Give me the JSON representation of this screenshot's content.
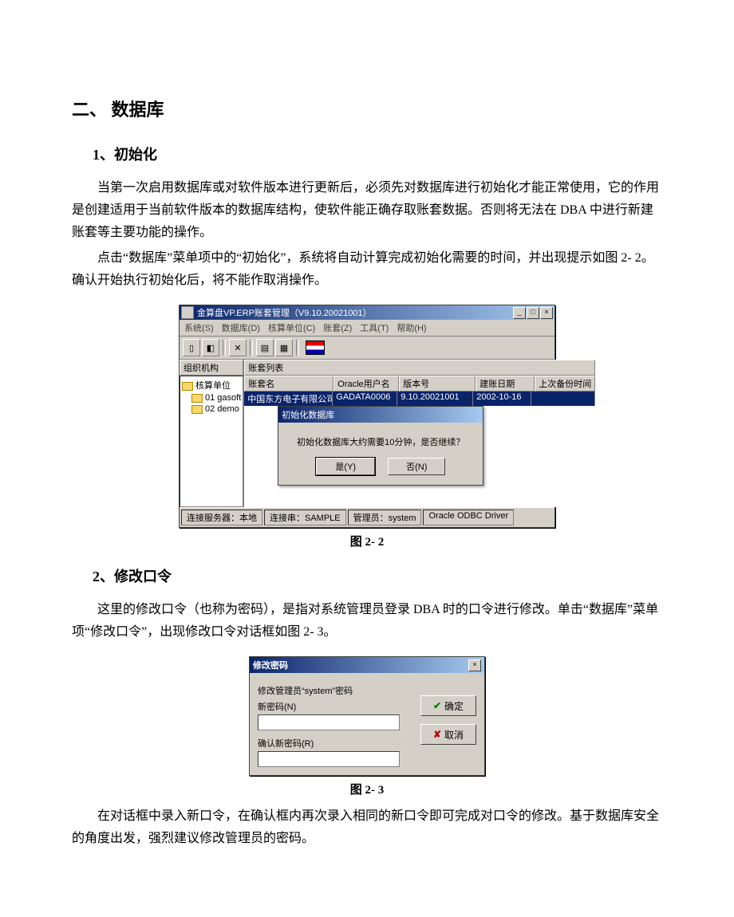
{
  "doc": {
    "h1": "二、 数据库",
    "sec1_title": "1、初始化",
    "sec1_p1": "当第一次启用数据库或对软件版本进行更新后，必须先对数据库进行初始化才能正常使用，它的作用是创建适用于当前软件版本的数据库结构，使软件能正确存取账套数据。否则将无法在 DBA 中进行新建账套等主要功能的操作。",
    "sec1_p2": "点击“数据库”菜单项中的“初始化”，系统将自动计算完成初始化需要的时间，并出现提示如图 2- 2。确认开始执行初始化后，将不能作取消操作。",
    "fig22_caption": "图 2- 2",
    "sec2_title": "2、修改口令",
    "sec2_p1": "这里的修改口令（也称为密码），是指对系统管理员登录 DBA 时的口令进行修改。单击“数据库”菜单项“修改口令”，出现修改口令对话框如图 2- 3。",
    "fig23_caption": "图 2- 3",
    "sec2_p2": "在对话框中录入新口令，在确认框内再次录入相同的新口令即可完成对口令的修改。基于数据库安全的角度出发，强烈建议修改管理员的密码。"
  },
  "app": {
    "title": "金算盘VP.ERP账套管理（V9.10.20021001）",
    "menus": [
      "系统(S)",
      "数据库(D)",
      "核算单位(C)",
      "账套(Z)",
      "工具(T)",
      "帮助(H)"
    ],
    "tree_title": "组织机构",
    "tree_root": "核算单位",
    "tree_items": [
      "01 gasoft",
      "02 demo"
    ],
    "list_title": "账套列表",
    "grid_headers": [
      "账套名",
      "Oracle用户名",
      "版本号",
      "建账日期",
      "上次备份时间"
    ],
    "grid_row": [
      "中国东方电子有限公司",
      "GADATA0006",
      "9.10.20021001",
      "2002-10-16",
      ""
    ],
    "dialog": {
      "title": "初始化数据库",
      "msg": "初始化数据库大约需要10分钟，是否继续？",
      "yes": "是(Y)",
      "no": "否(N)"
    },
    "status": {
      "s1": "连接服务器：本地",
      "s2": "连接串：SAMPLE",
      "s3": "管理员：system",
      "s4": "Oracle ODBC Driver"
    }
  },
  "pwd": {
    "title": "修改密码",
    "desc": "修改管理员“system”密码",
    "new_label": "新密码(N)",
    "confirm_label": "确认新密码(R)",
    "ok": "确定",
    "cancel": "取消"
  }
}
